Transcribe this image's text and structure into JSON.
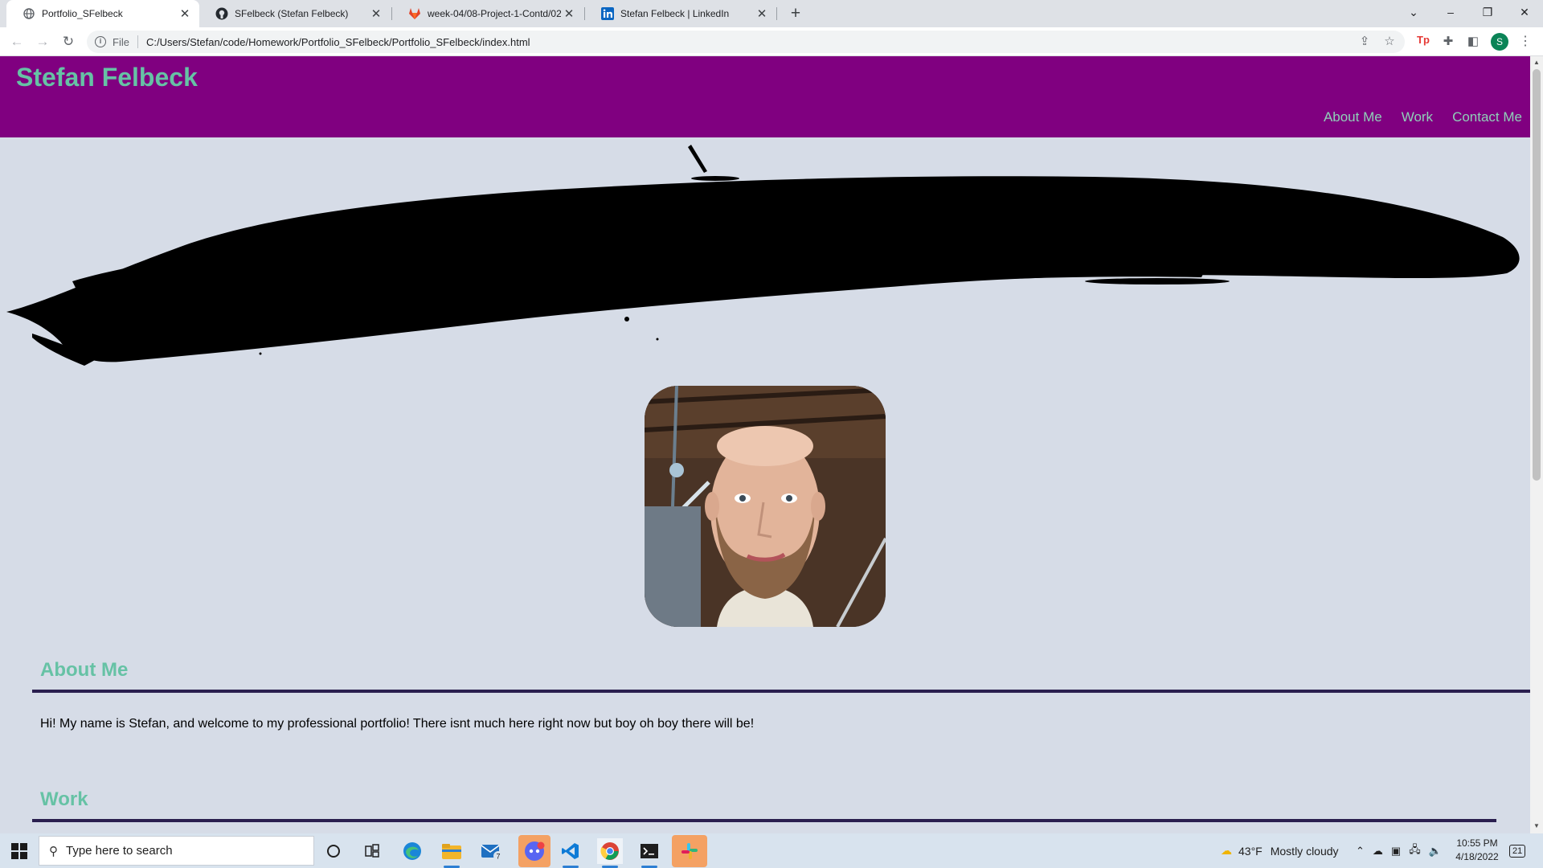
{
  "browser": {
    "tabs": [
      {
        "title": "Portfolio_SFelbeck",
        "icon": "globe-icon",
        "active": true
      },
      {
        "title": "SFelbeck (Stefan Felbeck)",
        "icon": "github-icon",
        "active": false
      },
      {
        "title": "week-04/08-Project-1-Contd/02-",
        "icon": "gitlab-icon",
        "active": false
      },
      {
        "title": "Stefan Felbeck | LinkedIn",
        "icon": "linkedin-icon",
        "active": false
      }
    ],
    "address": {
      "scheme": "File",
      "url": "C:/Users/Stefan/code/Homework/Portfolio_SFelbeck/Portfolio_SFelbeck/index.html"
    },
    "profile_initial": "S",
    "extension_label": "Tp"
  },
  "site": {
    "name": "Stefan Felbeck",
    "nav": [
      "About Me",
      "Work",
      "Contact Me"
    ],
    "header_color": "#800080",
    "accent_color": "#66c2a5",
    "background_color": "#d6dce7"
  },
  "sections": {
    "about": {
      "title": "About Me",
      "text": "Hi! My name is Stefan, and welcome to my professional portfolio! There isnt much here right now but boy oh boy there will be!"
    },
    "work": {
      "title": "Work"
    }
  },
  "taskbar": {
    "search_placeholder": "Type here to search",
    "apps": [
      "cortana-icon",
      "task-view-icon",
      "edge-icon",
      "file-explorer-icon",
      "mail-icon",
      "discord-icon",
      "vscode-icon",
      "chrome-icon",
      "terminal-icon",
      "slack-icon"
    ],
    "mail_badge": "7",
    "weather": {
      "temp": "43°F",
      "condition": "Mostly cloudy"
    },
    "time": "10:55 PM",
    "date": "4/18/2022",
    "notification_count": "21"
  }
}
